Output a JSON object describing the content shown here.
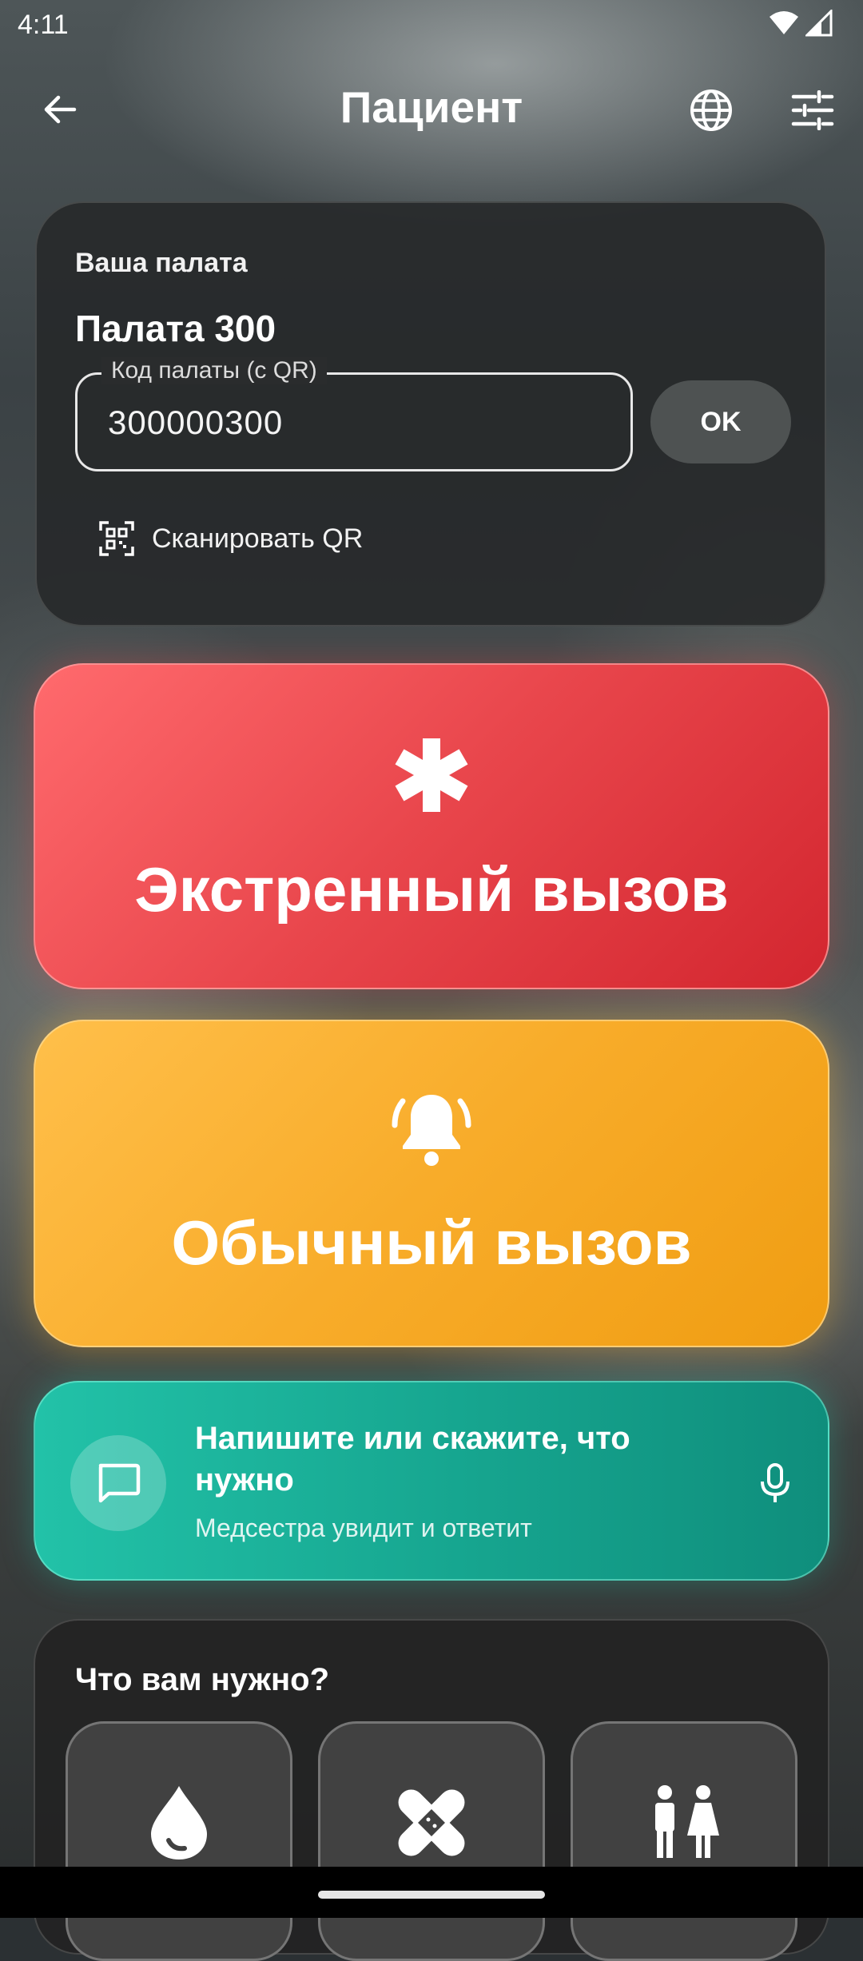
{
  "status_bar": {
    "time": "4:11"
  },
  "app_bar": {
    "title": "Пациент"
  },
  "room": {
    "caption": "Ваша палата",
    "name": "Палата 300",
    "code_label": "Код палаты (с QR)",
    "code_value": "300000300",
    "ok_label": "OK",
    "scan_label": "Сканировать QR"
  },
  "emergency": {
    "label": "Экстренный вызов",
    "color": "#e8454b"
  },
  "regular": {
    "label": "Обычный вызов",
    "color": "#f8ac2a"
  },
  "message": {
    "title": "Напишите или скажите, что нужно",
    "subtitle": "Медсестра увидит и ответит",
    "color": "#16a58f"
  },
  "needs": {
    "title": "Что вам нужно?",
    "items": [
      {
        "icon": "water-drop-icon"
      },
      {
        "icon": "bandage-icon"
      },
      {
        "icon": "restroom-icon"
      }
    ]
  }
}
